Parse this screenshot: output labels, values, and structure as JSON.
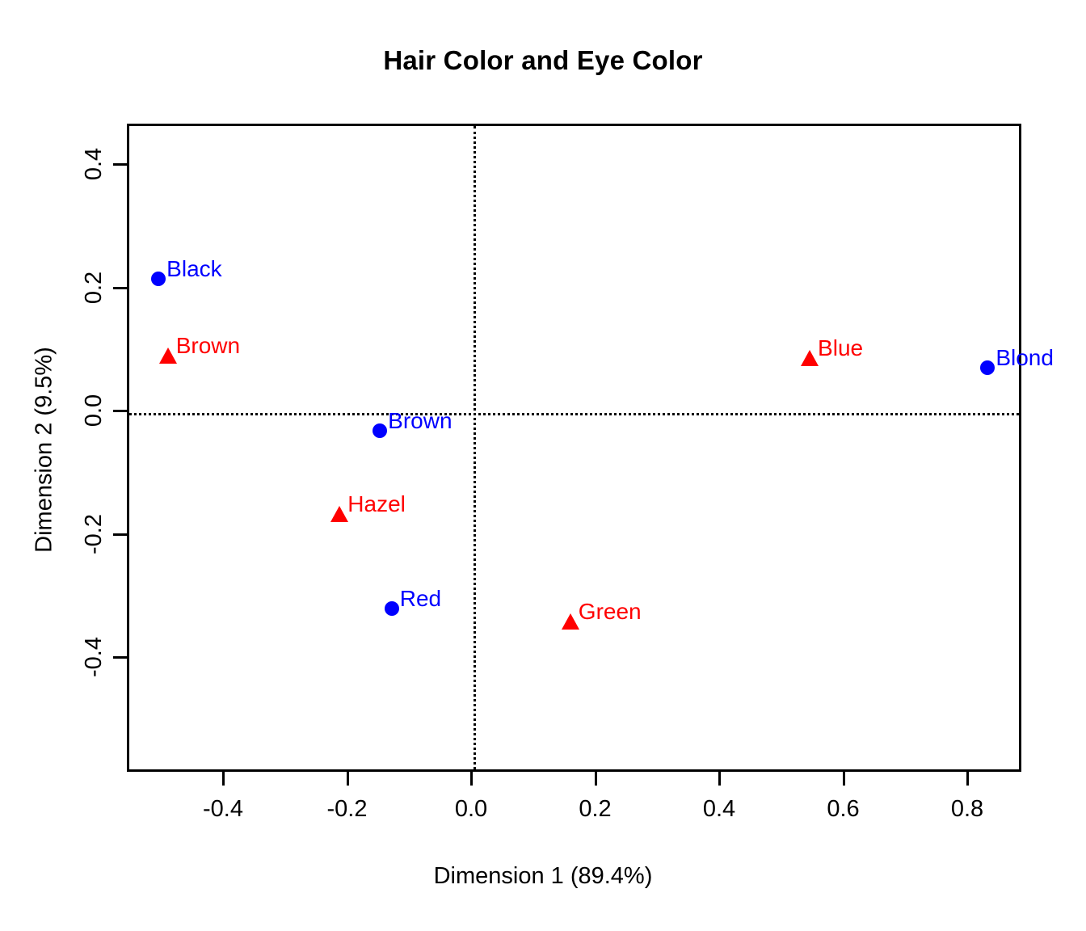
{
  "chart_data": {
    "type": "scatter",
    "title": "Hair Color and Eye Color",
    "xlabel": "Dimension 1 (89.4%)",
    "ylabel": "Dimension 2 (9.5%)",
    "xlim": [
      -0.553,
      0.888
    ],
    "ylim": [
      -0.527,
      0.525
    ],
    "xticks": [
      "-0.4",
      "-0.2",
      "0.0",
      "0.2",
      "0.4",
      "0.6",
      "0.8"
    ],
    "xtick_values": [
      -0.4,
      -0.2,
      0.0,
      0.2,
      0.4,
      0.6,
      0.8
    ],
    "yticks": [
      "0.4",
      "0.2",
      "0.0",
      "-0.2",
      "-0.4"
    ],
    "ytick_values": [
      0.4,
      0.2,
      0.0,
      -0.2,
      -0.4
    ],
    "grid": false,
    "legend": "none",
    "reference_lines": {
      "horizontal": 0.0,
      "vertical": 0.0,
      "style": "dotted",
      "color": "#000000"
    },
    "series": [
      {
        "name": "Hair Color",
        "marker": "circle",
        "color": "#0000ff",
        "points": [
          {
            "label": "Black",
            "x": -0.504,
            "y": 0.214,
            "label_pos": "upper-right"
          },
          {
            "label": "Brown",
            "x": -0.147,
            "y": -0.033,
            "label_pos": "upper-right"
          },
          {
            "label": "Red",
            "x": -0.128,
            "y": -0.321,
            "label_pos": "upper-right"
          },
          {
            "label": "Blond",
            "x": 0.833,
            "y": 0.07,
            "label_pos": "upper-right"
          }
        ]
      },
      {
        "name": "Eye Color",
        "marker": "triangle",
        "color": "#ff0000",
        "points": [
          {
            "label": "Brown",
            "x": -0.489,
            "y": 0.089,
            "label_pos": "upper-right"
          },
          {
            "label": "Blue",
            "x": 0.546,
            "y": 0.085,
            "label_pos": "upper-right"
          },
          {
            "label": "Hazel",
            "x": -0.212,
            "y": -0.168,
            "label_pos": "upper-right"
          },
          {
            "label": "Green",
            "x": 0.16,
            "y": -0.342,
            "label_pos": "upper-right"
          }
        ]
      }
    ]
  }
}
